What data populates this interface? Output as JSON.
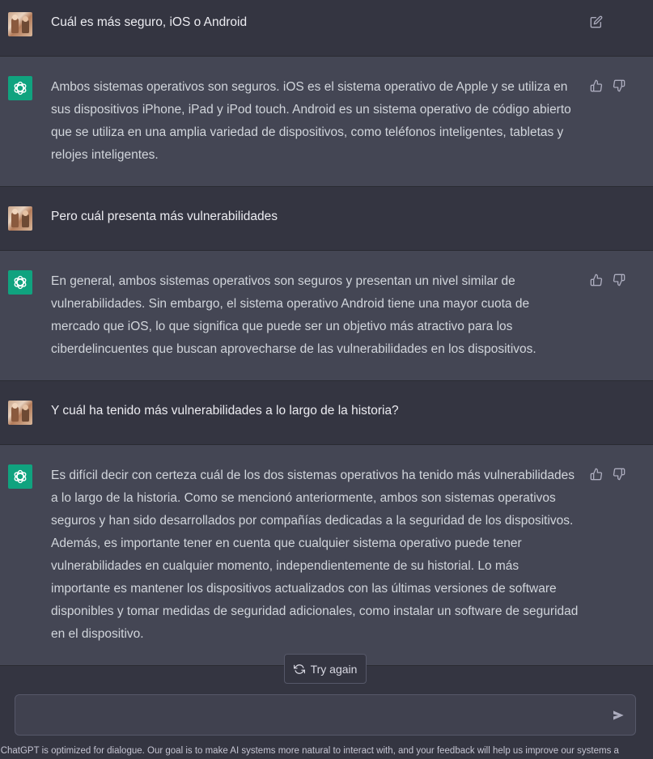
{
  "conversation": {
    "messages": [
      {
        "role": "user",
        "text": "Cuál es más seguro, iOS o Android"
      },
      {
        "role": "assistant",
        "text": "Ambos sistemas operativos son seguros. iOS es el sistema operativo de Apple y se utiliza en sus dispositivos iPhone, iPad y iPod touch. Android es un sistema operativo de código abierto que se utiliza en una amplia variedad de dispositivos, como teléfonos inteligentes, tabletas y relojes inteligentes."
      },
      {
        "role": "user",
        "text": "Pero cuál presenta más vulnerabilidades"
      },
      {
        "role": "assistant",
        "text": "En general, ambos sistemas operativos son seguros y presentan un nivel similar de vulnerabilidades. Sin embargo, el sistema operativo Android tiene una mayor cuota de mercado que iOS, lo que significa que puede ser un objetivo más atractivo para los ciberdelincuentes que buscan aprovecharse de las vulnerabilidades en los dispositivos."
      },
      {
        "role": "user",
        "text": "Y cuál ha tenido más vulnerabilidades a lo largo de la historia?"
      },
      {
        "role": "assistant",
        "text": "Es difícil decir con certeza cuál de los dos sistemas operativos ha tenido más vulnerabilidades a lo largo de la historia. Como se mencionó anteriormente, ambos son sistemas operativos seguros y han sido desarrollados por compañías dedicadas a la seguridad de los dispositivos. Además, es importante tener en cuenta que cualquier sistema operativo puede tener vulnerabilidades en cualquier momento, independientemente de su historial. Lo más importante es mantener los dispositivos actualizados con las últimas versiones de software disponibles y tomar medidas de seguridad adicionales, como instalar un software de seguridad en el dispositivo."
      }
    ]
  },
  "controls": {
    "try_again_label": "Try again",
    "composer_placeholder": ""
  },
  "footer": {
    "text": "w: ChatGPT is optimized for dialogue. Our goal is to make AI systems more natural to interact with, and your feedback will help us improve our systems a"
  },
  "icons": {
    "edit": "edit-icon",
    "thumbs_up": "thumbs-up-icon",
    "thumbs_down": "thumbs-down-icon",
    "refresh": "refresh-icon",
    "send": "send-icon",
    "openai_logo": "openai-logo-icon"
  },
  "colors": {
    "background": "#343541",
    "assistant_background": "#444654",
    "brand": "#10a37f",
    "text": "#d1d5db"
  }
}
